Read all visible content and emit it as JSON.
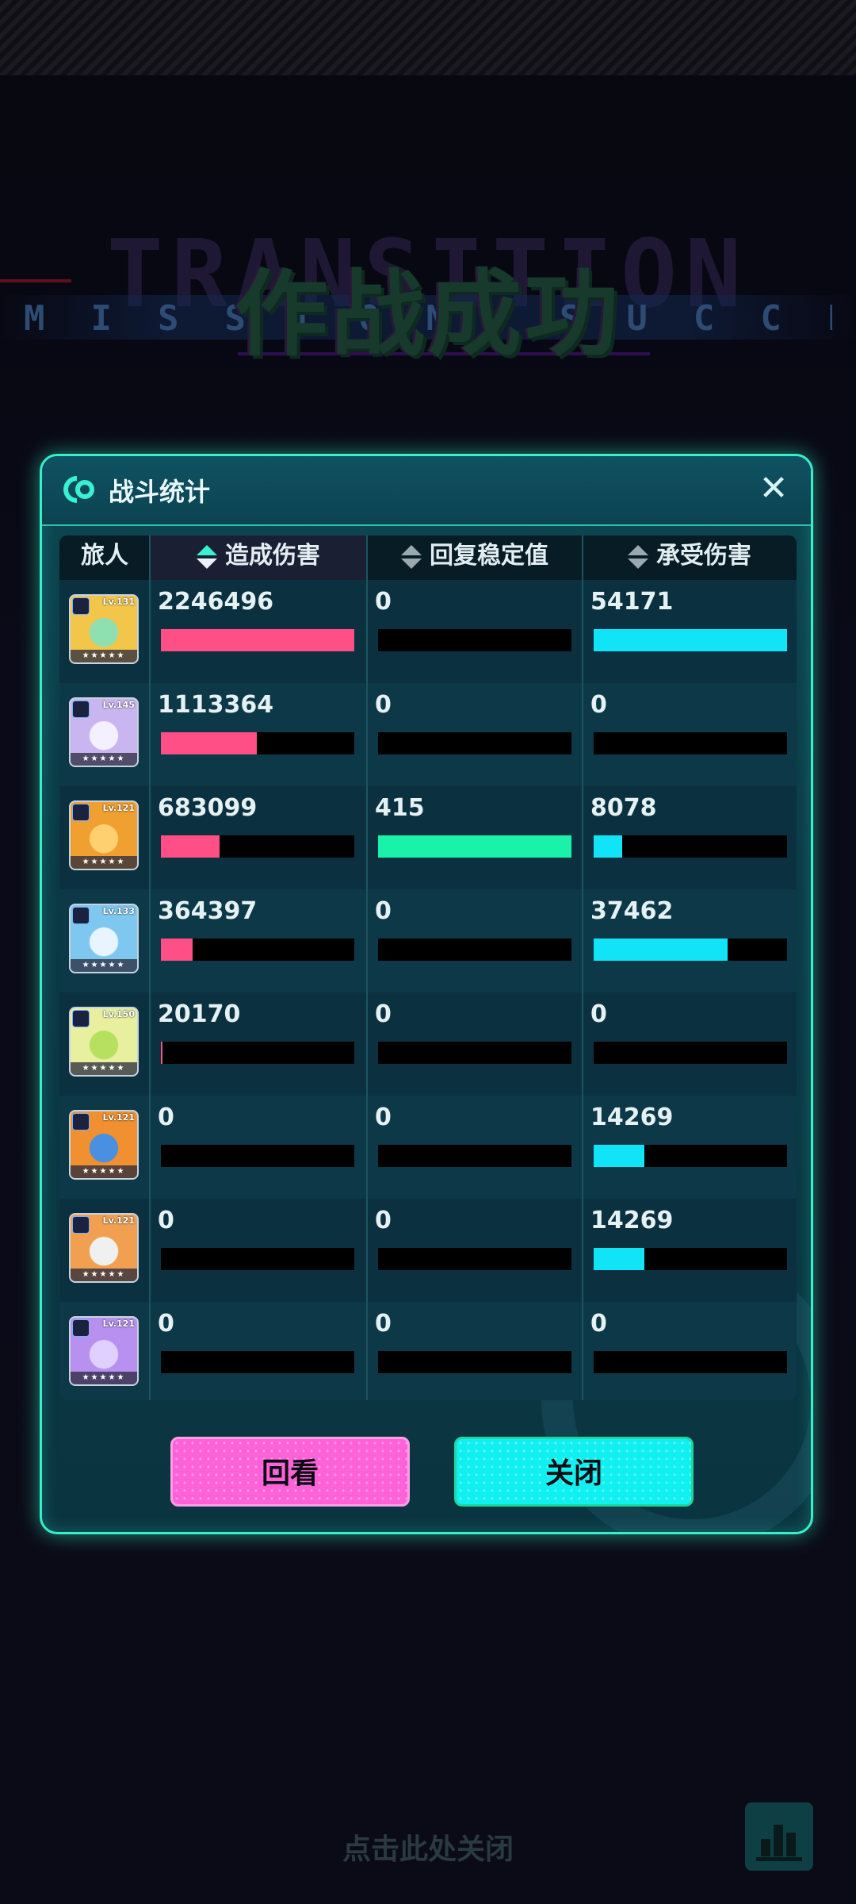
{
  "background": {
    "wordmark": "TRANSITION",
    "band_text": "MISSION SUCCEED",
    "title": "作战成功"
  },
  "panel": {
    "title": "战斗统计",
    "close_icon": "close-icon"
  },
  "table": {
    "headers": {
      "traveler": "旅人",
      "damage_dealt": "造成伤害",
      "stability_restored": "回复稳定值",
      "damage_taken": "承受伤害"
    },
    "active_sort": "damage_dealt",
    "rows": [
      {
        "level": "Lv.131",
        "stars": "★★★★★",
        "portrait_color": "#f2c64a",
        "accent": "#8fe0b0",
        "damage_dealt": "2246496",
        "damage_fill": 1.0,
        "stability": "0",
        "stability_fill": 0.0,
        "taken": "54171",
        "taken_fill": 1.0
      },
      {
        "level": "Lv.145",
        "stars": "★★★★★",
        "portrait_color": "#c9b6f0",
        "accent": "#f4f0ff",
        "damage_dealt": "1113364",
        "damage_fill": 0.496,
        "stability": "0",
        "stability_fill": 0.0,
        "taken": "0",
        "taken_fill": 0.0
      },
      {
        "level": "Lv.121",
        "stars": "★★★★★",
        "portrait_color": "#f0a030",
        "accent": "#ffd070",
        "damage_dealt": "683099",
        "damage_fill": 0.304,
        "stability": "415",
        "stability_fill": 1.0,
        "taken": "8078",
        "taken_fill": 0.149
      },
      {
        "level": "Lv.133",
        "stars": "★★★★★",
        "portrait_color": "#7ec8f0",
        "accent": "#e8f4ff",
        "damage_dealt": "364397",
        "damage_fill": 0.162,
        "stability": "0",
        "stability_fill": 0.0,
        "taken": "37462",
        "taken_fill": 0.692
      },
      {
        "level": "Lv.150",
        "stars": "★★★★★",
        "portrait_color": "#e8f0a0",
        "accent": "#b8e060",
        "damage_dealt": "20170",
        "damage_fill": 0.009,
        "stability": "0",
        "stability_fill": 0.0,
        "taken": "0",
        "taken_fill": 0.0
      },
      {
        "level": "Lv.121",
        "stars": "★★★★★",
        "portrait_color": "#f09030",
        "accent": "#4a90e0",
        "damage_dealt": "0",
        "damage_fill": 0.0,
        "stability": "0",
        "stability_fill": 0.0,
        "taken": "14269",
        "taken_fill": 0.263
      },
      {
        "level": "Lv.121",
        "stars": "★★★★★",
        "portrait_color": "#f0a050",
        "accent": "#f0f0f0",
        "damage_dealt": "0",
        "damage_fill": 0.0,
        "stability": "0",
        "stability_fill": 0.0,
        "taken": "14269",
        "taken_fill": 0.263
      },
      {
        "level": "Lv.121",
        "stars": "★★★★★",
        "portrait_color": "#b890f0",
        "accent": "#e0d0ff",
        "damage_dealt": "0",
        "damage_fill": 0.0,
        "stability": "0",
        "stability_fill": 0.0,
        "taken": "0",
        "taken_fill": 0.0
      }
    ]
  },
  "buttons": {
    "replay": "回看",
    "close": "关闭"
  },
  "footer": {
    "hint": "点击此处关闭",
    "stats_icon": "bar-chart-icon"
  },
  "colors": {
    "damage_bar": "#ff4f86",
    "stability_bar": "#19f2a8",
    "taken_bar": "#12e4f8",
    "panel_border": "#35f0c8"
  }
}
